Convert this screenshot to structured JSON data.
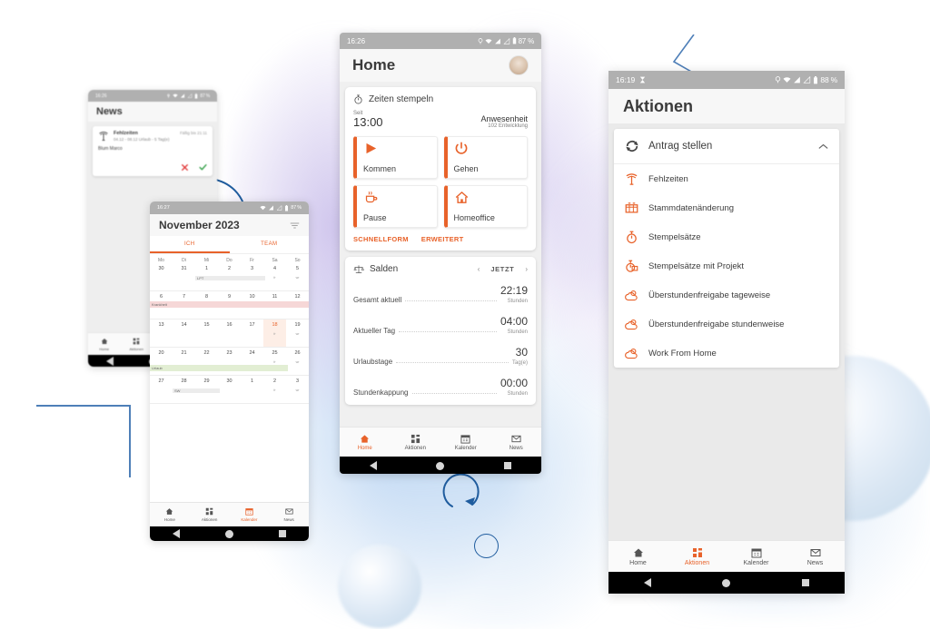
{
  "theme": {
    "accent": "#e8622a",
    "deco_blue": "#1f5c9e",
    "statusbar_bg": "#b0b0b0"
  },
  "phone_home": {
    "status": {
      "time": "16:26",
      "battery": "87 %",
      "icons": "location-wifi-signal-battery"
    },
    "appbar": {
      "title": "Home",
      "avatar": "user-avatar"
    },
    "stamp_card": {
      "icon": "stopwatch-icon",
      "title": "Zeiten stempeln",
      "since_label": "Seit",
      "since_value": "13:00",
      "presence_label": "Anwesenheit",
      "presence_sub": "102 Entwicklung",
      "buttons": [
        {
          "label": "Kommen",
          "icon": "play-icon"
        },
        {
          "label": "Gehen",
          "icon": "power-icon"
        },
        {
          "label": "Pause",
          "icon": "coffee-icon"
        },
        {
          "label": "Homeoffice",
          "icon": "house-icon"
        }
      ],
      "links": [
        "SCHNELLFORM",
        "ERWEITERT"
      ]
    },
    "balance_card": {
      "icon": "scales-icon",
      "title": "Salden",
      "prev": "‹",
      "now": "JETZT",
      "next": "›",
      "rows": [
        {
          "label": "Gesamt aktuell",
          "value": "22:19",
          "unit": "Stunden"
        },
        {
          "label": "Aktueller Tag",
          "value": "04:00",
          "unit": "Stunden"
        },
        {
          "label": "Urlaubstage",
          "value": "30",
          "unit": "Tag(e)"
        },
        {
          "label": "Stundenkappung",
          "value": "00:00",
          "unit": "Stunden"
        }
      ]
    },
    "navbar": [
      {
        "label": "Home",
        "icon": "home-icon",
        "active": true
      },
      {
        "label": "Aktionen",
        "icon": "grid-icon",
        "active": false
      },
      {
        "label": "Kalender",
        "icon": "calendar-icon",
        "active": false
      },
      {
        "label": "News",
        "icon": "envelope-icon",
        "active": false
      }
    ]
  },
  "phone_aktionen": {
    "status": {
      "time": "16:19",
      "battery": "88 %",
      "icons": "hourglass-location-wifi-signal-battery"
    },
    "appbar": {
      "title": "Aktionen"
    },
    "group": {
      "icon": "refresh-cycle-icon",
      "title": "Antrag stellen",
      "chevron": "chevron-up-icon",
      "items": [
        {
          "label": "Fehlzeiten",
          "icon": "palm-tree-icon"
        },
        {
          "label": "Stammdatenänderung",
          "icon": "form-icon"
        },
        {
          "label": "Stempelsätze",
          "icon": "stopwatch-icon"
        },
        {
          "label": "Stempelsätze mit Projekt",
          "icon": "stopwatch-project-icon"
        },
        {
          "label": "Überstundenfreigabe tageweise",
          "icon": "cloud-sun-icon"
        },
        {
          "label": "Überstundenfreigabe stundenweise",
          "icon": "cloud-sun-icon"
        },
        {
          "label": "Work From Home",
          "icon": "cloud-sun-icon"
        }
      ]
    },
    "navbar": [
      {
        "label": "Home",
        "icon": "home-icon",
        "active": false
      },
      {
        "label": "Aktionen",
        "icon": "grid-icon",
        "active": true
      },
      {
        "label": "Kalender",
        "icon": "calendar-icon",
        "active": false
      },
      {
        "label": "News",
        "icon": "envelope-icon",
        "active": false
      }
    ]
  },
  "phone_news": {
    "status": {
      "time": "16:26",
      "battery": "87 %"
    },
    "appbar": {
      "title": "News"
    },
    "card": {
      "icon": "palm-tree-icon",
      "title": "Fehlzeiten",
      "subtitle": "04.12 - 08.12 Urlaub - 5 Tag(e)",
      "date": "Fällig bis 21:11",
      "name": "Blum Marco",
      "reject_icon": "reject-cross-icon",
      "accept_icon": "accept-check-icon"
    },
    "navbar": [
      {
        "label": "Home",
        "icon": "home-icon",
        "active": false
      },
      {
        "label": "Aktionen",
        "icon": "grid-icon",
        "active": false
      }
    ]
  },
  "phone_kalender": {
    "status": {
      "time": "16:27",
      "battery": "87 %"
    },
    "appbar": {
      "title": "November 2023",
      "filter_icon": "filter-icon"
    },
    "tabs": [
      {
        "label": "ICH",
        "active": true
      },
      {
        "label": "TEAM",
        "active": false
      }
    ],
    "day_headers": [
      "Mo",
      "Di",
      "Mi",
      "Do",
      "Fr",
      "Sa",
      "So"
    ],
    "weeks": [
      {
        "days": [
          "30",
          "31",
          "1",
          "2",
          "3",
          "4",
          "5"
        ],
        "subs": [
          "",
          "",
          "",
          "",
          "",
          "fr",
          "wr"
        ],
        "band": {
          "label": "LPT",
          "type": "ev",
          "start": 2,
          "span": 3
        }
      },
      {
        "days": [
          "6",
          "7",
          "8",
          "9",
          "10",
          "11",
          "12"
        ],
        "subs": [
          "",
          "",
          "",
          "",
          "",
          "",
          ""
        ],
        "band": {
          "label": "Krankheit",
          "type": "sick",
          "start": 0,
          "span": 7
        }
      },
      {
        "days": [
          "13",
          "14",
          "15",
          "16",
          "17",
          "18",
          "19"
        ],
        "subs": [
          "",
          "",
          "",
          "",
          "",
          "fr",
          "wr"
        ],
        "today_index": 5,
        "band": null
      },
      {
        "days": [
          "20",
          "21",
          "22",
          "23",
          "24",
          "25",
          "26"
        ],
        "subs": [
          "",
          "",
          "",
          "",
          "",
          "fr",
          "wr"
        ],
        "band": {
          "label": "Urlaub",
          "type": "vac",
          "start": 0,
          "span": 6
        }
      },
      {
        "days": [
          "27",
          "28",
          "29",
          "30",
          "1",
          "2",
          "3"
        ],
        "subs": [
          "",
          "",
          "",
          "",
          "",
          "fr",
          "wr"
        ],
        "band": {
          "label": "SW",
          "type": "ev",
          "start": 1,
          "span": 2
        }
      }
    ],
    "navbar": [
      {
        "label": "Home",
        "icon": "home-icon",
        "active": false
      },
      {
        "label": "Aktionen",
        "icon": "grid-icon",
        "active": false
      },
      {
        "label": "Kalender",
        "icon": "calendar-icon",
        "active": true
      },
      {
        "label": "News",
        "icon": "envelope-icon",
        "active": false
      }
    ]
  },
  "decorations": [
    {
      "name": "corner-bracket",
      "color": "#4e7fb8"
    },
    {
      "name": "chevron-line",
      "color": "#4e7fb8"
    },
    {
      "name": "ring-circle",
      "color": "#1f5c9e"
    },
    {
      "name": "ring-small",
      "color": "#1f5c9e"
    },
    {
      "name": "arrow-circle",
      "color": "#1f5c9e"
    },
    {
      "name": "sphere-large",
      "color": "#d9e6f3"
    },
    {
      "name": "sphere-small",
      "color": "#d9e6f3"
    }
  ]
}
